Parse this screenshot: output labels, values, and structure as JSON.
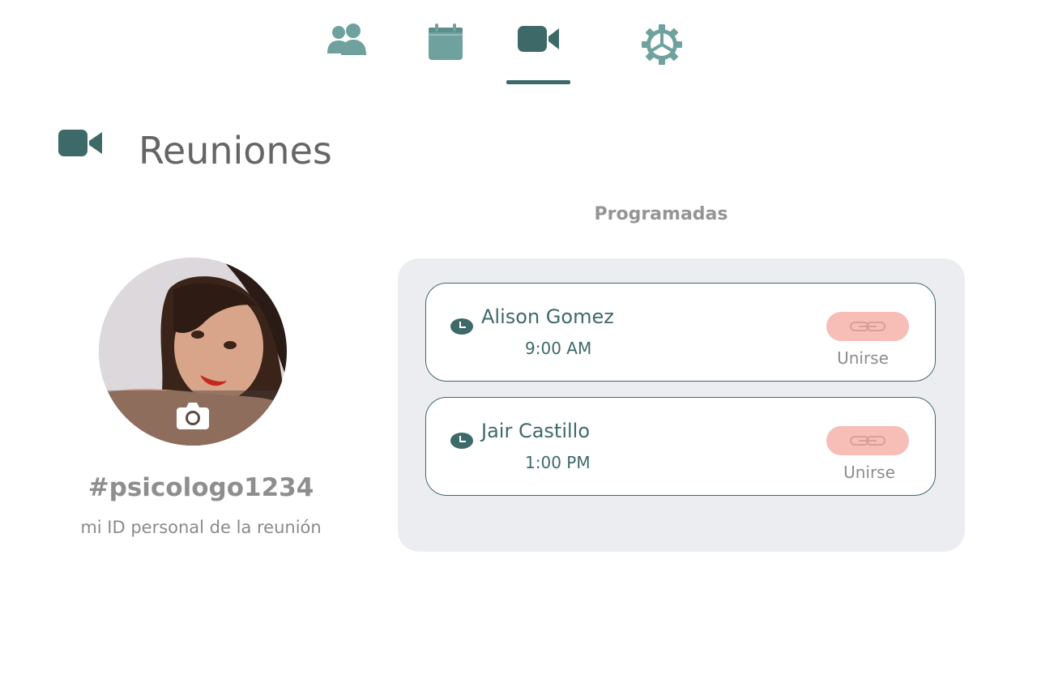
{
  "nav": {
    "items": [
      {
        "icon": "people-icon"
      },
      {
        "icon": "calendar-icon"
      },
      {
        "icon": "video-camera-icon",
        "active": true
      },
      {
        "icon": "gear-icon"
      }
    ],
    "colors": {
      "active": "#3d6a68",
      "inactive": "#6fa29f"
    }
  },
  "page": {
    "title": "Reuniones",
    "icon": "video-camera-icon"
  },
  "profile": {
    "avatar_icon": "camera-icon",
    "meeting_id": "#psicologo1234",
    "meeting_id_caption": "mi ID personal de la reunión"
  },
  "meetings": {
    "section_title": "Programadas",
    "items": [
      {
        "name": "Alison Gomez",
        "time": "9:00 AM",
        "join_label": "Unirse",
        "join_icon": "link-icon"
      },
      {
        "name": "Jair Castillo",
        "time": "1:00 PM",
        "join_label": "Unirse",
        "join_icon": "link-icon"
      }
    ]
  },
  "colors": {
    "accent": "#3d6a68",
    "join_button": "#f7bdb7",
    "panel": "#ecedf1"
  }
}
